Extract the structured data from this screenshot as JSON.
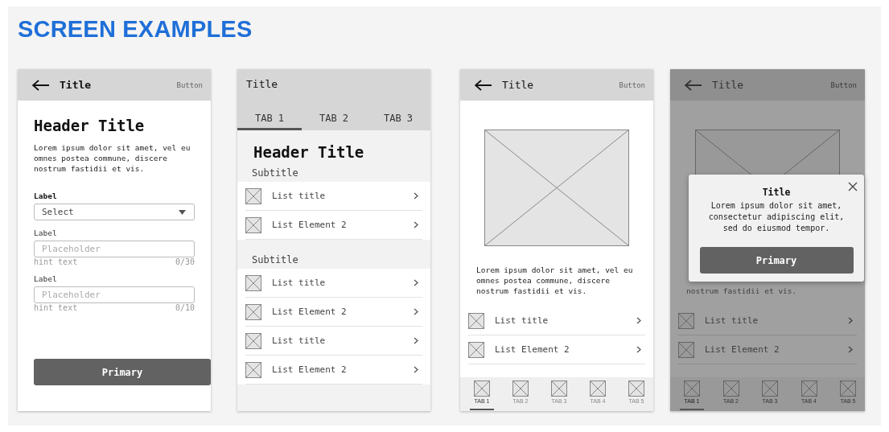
{
  "title": "SCREEN EXAMPLES",
  "screens": [
    {
      "kind": "form",
      "dimmed": false,
      "app_bar": {
        "back": true,
        "title": "Title",
        "action": "Button"
      },
      "header": "Header Title",
      "body": "Lorem ipsum dolor sit amet, vel eu omnes postea commune, discere nostrum fastidii et vis.",
      "fields": [
        {
          "kind": "select",
          "label": "Label",
          "value": "Select"
        },
        {
          "kind": "text",
          "label": "Label",
          "placeholder": "Placeholder",
          "hint": "hint text",
          "counter": "0/30"
        },
        {
          "kind": "text",
          "label": "Label",
          "placeholder": "Placeholder",
          "hint": "hint text",
          "counter": "0/10"
        }
      ],
      "button": "Primary"
    },
    {
      "kind": "list",
      "dimmed": false,
      "app_bar": {
        "back": false,
        "title": "Title"
      },
      "tabs": [
        {
          "label": "TAB 1",
          "selected": true
        },
        {
          "label": "TAB 2",
          "selected": false
        },
        {
          "label": "TAB 3",
          "selected": false
        }
      ],
      "header": "Header Title",
      "sections": [
        {
          "subtitle": "Subtitle",
          "items": [
            "List title",
            "List Element 2"
          ]
        },
        {
          "subtitle": "Subtitle",
          "items": [
            "List title",
            "List Element 2",
            "List title",
            "List Element 2"
          ]
        }
      ]
    },
    {
      "kind": "media",
      "dimmed": false,
      "app_bar": {
        "back": true,
        "title": "Title",
        "action": "Button"
      },
      "body": "Lorem ipsum dolor sit amet, vel eu omnes postea commune, discere nostrum fastidii et vis.",
      "items": [
        "List title",
        "List Element 2"
      ],
      "bottom_tabs": [
        {
          "label": "TAB 1",
          "selected": true
        },
        {
          "label": "TAB 2",
          "selected": false
        },
        {
          "label": "TAB 3",
          "selected": false
        },
        {
          "label": "TAB 4",
          "selected": false
        },
        {
          "label": "TAB 5",
          "selected": false
        }
      ]
    },
    {
      "kind": "media",
      "dimmed": true,
      "app_bar": {
        "back": true,
        "title": "Title",
        "action": "Button"
      },
      "body": "nostrum fastidii et vis.",
      "items": [
        "List title",
        "List Element 2"
      ],
      "bottom_tabs": [
        {
          "label": "TAB 1",
          "selected": true
        },
        {
          "label": "TAB 2",
          "selected": false
        },
        {
          "label": "TAB 3",
          "selected": false
        },
        {
          "label": "TAB 4",
          "selected": false
        },
        {
          "label": "TAB 5",
          "selected": false
        }
      ],
      "dialog": {
        "title": "Title",
        "body": "Lorem ipsum dolor sit amet, consectetur adipiscing elit, sed do eiusmod tempor.",
        "button": "Primary"
      }
    }
  ]
}
